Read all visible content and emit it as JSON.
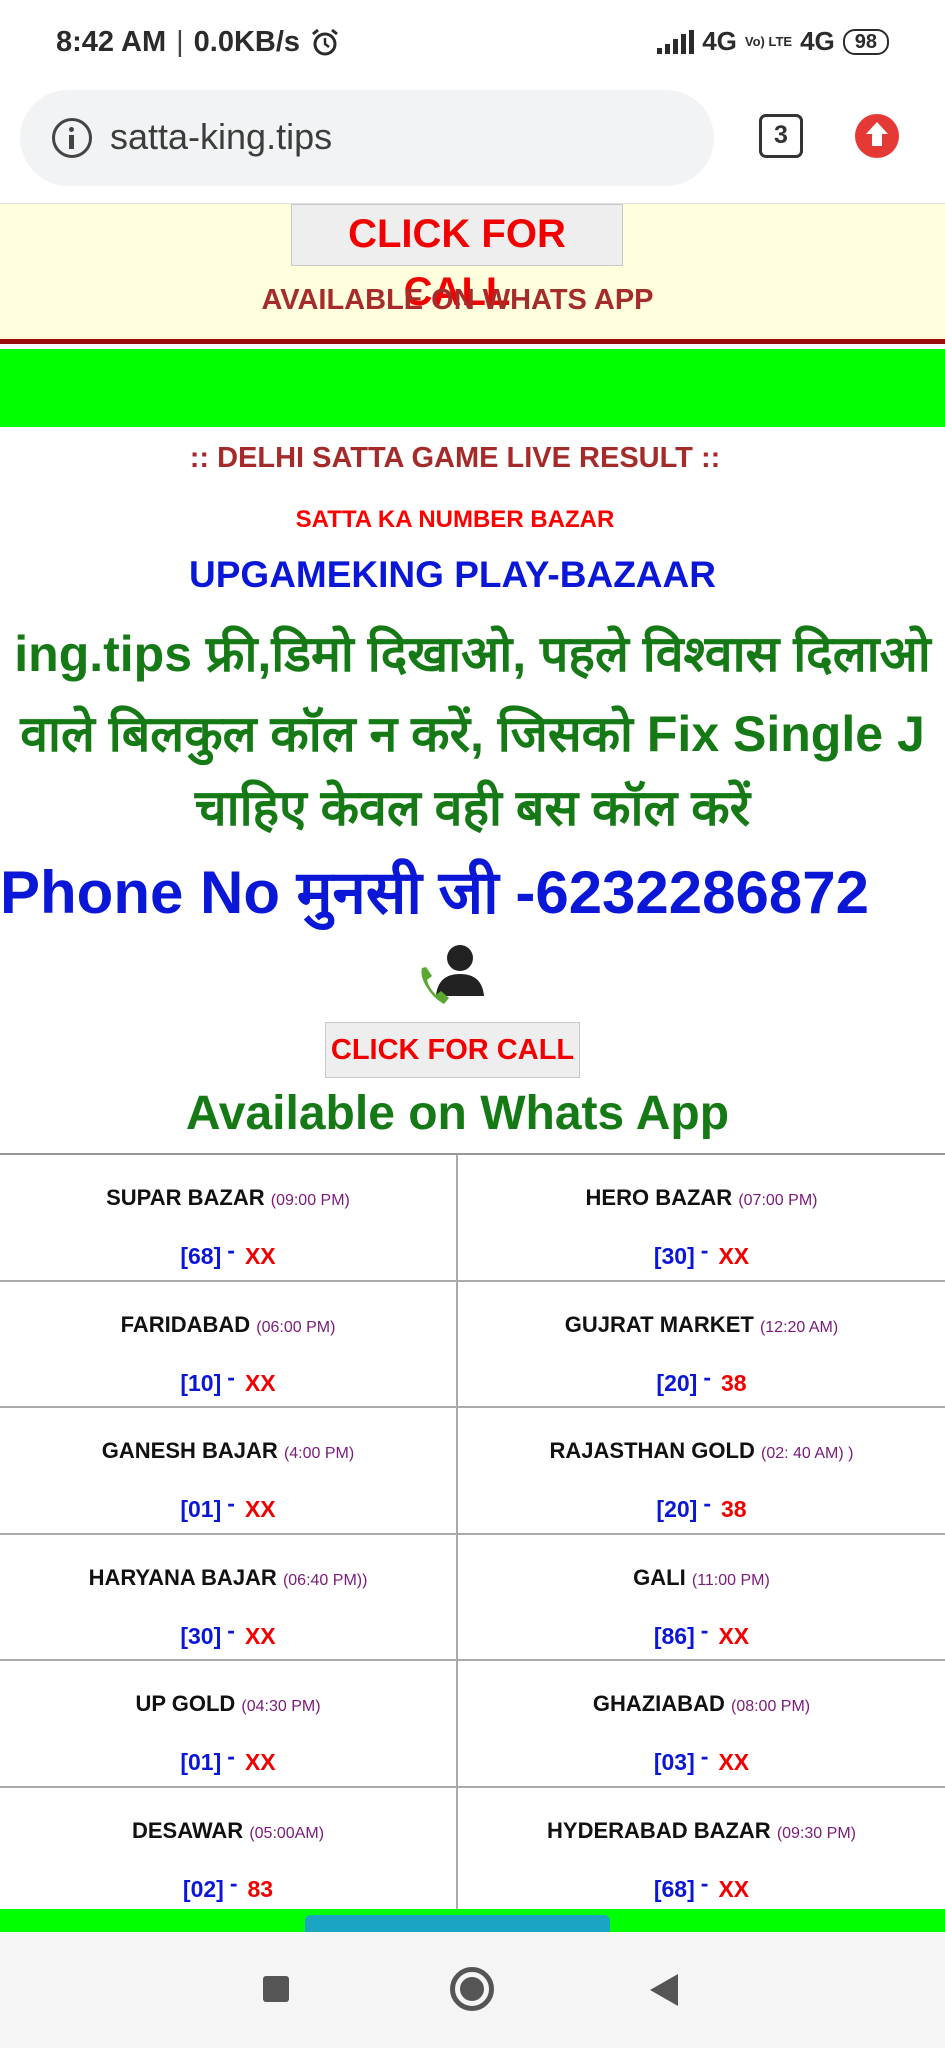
{
  "status_bar": {
    "time": "8:42 AM",
    "network_speed": "0.0KB/s",
    "signal_1": "4G",
    "volte": "Vo) LTE",
    "signal_2": "4G",
    "battery": "98"
  },
  "browser": {
    "url": "satta-king.tips",
    "tab_count": "3"
  },
  "page": {
    "top_call_button": "CLICK FOR CALL",
    "top_available": "AVAILABLE ON WHATS APP",
    "heading_delhi": ":: DELHI SATTA GAME LIVE RESULT ::",
    "heading_satta": "SATTA KA NUMBER BAZAR",
    "heading_upgame": "UPGAMEKING PLAY-BAZAAR",
    "hindi_line_1": "ing.tips फ्री,डिमो दिखाओ, पहले विश्वास दिलाओ",
    "hindi_line_2": "वाले बिलकुल कॉल न करें, जिसको Fix Single J",
    "hindi_line_3": "चाहिए केवल वही बस कॉल करें",
    "phone_line": "Phone No मुनसी जी -6232286872",
    "call_button": "CLICK FOR CALL",
    "available": "Available on Whats App"
  },
  "results": [
    {
      "left": {
        "name": "SUPAR BAZAR",
        "time": "(09:00 PM)",
        "number": "[68]",
        "dash": "-",
        "value": "XX"
      },
      "right": {
        "name": "HERO BAZAR",
        "time": "(07:00 PM)",
        "number": "[30]",
        "dash": "-",
        "value": "XX"
      }
    },
    {
      "left": {
        "name": "FARIDABAD",
        "time": "(06:00 PM)",
        "number": "[10]",
        "dash": "-",
        "value": "XX"
      },
      "right": {
        "name": "GUJRAT MARKET",
        "time": "(12:20 AM)",
        "number": "[20]",
        "dash": "-",
        "value": "38"
      }
    },
    {
      "left": {
        "name": "GANESH BAJAR",
        "time": "(4:00 PM)",
        "number": "[01]",
        "dash": "-",
        "value": "XX"
      },
      "right": {
        "name": "RAJASTHAN GOLD",
        "time": "(02: 40 AM) )",
        "number": "[20]",
        "dash": "-",
        "value": "38"
      }
    },
    {
      "left": {
        "name": "HARYANA BAJAR",
        "time": "(06:40 PM))",
        "number": "[30]",
        "dash": "-",
        "value": "XX"
      },
      "right": {
        "name": "GALI",
        "time": "(11:00 PM)",
        "number": "[86]",
        "dash": "-",
        "value": "XX"
      }
    },
    {
      "left": {
        "name": "UP GOLD",
        "time": "(04:30 PM)",
        "number": "[01]",
        "dash": "-",
        "value": "XX"
      },
      "right": {
        "name": "GHAZIABAD",
        "time": "(08:00 PM)",
        "number": "[03]",
        "dash": "-",
        "value": "XX"
      }
    },
    {
      "left": {
        "name": "DESAWAR",
        "time": "(05:00AM)",
        "number": "[02]",
        "dash": "-",
        "value": "83"
      },
      "right": {
        "name": "HYDERABAD BAZAR",
        "time": "(09:30 PM)",
        "number": "[68]",
        "dash": "-",
        "value": "XX"
      }
    }
  ],
  "icons": {
    "alarm": "alarm-icon",
    "info": "info-icon",
    "update": "update-arrow-icon",
    "call": "phone-contact-icon",
    "nav_recent": "square-icon",
    "nav_home": "circle-icon",
    "nav_back": "triangle-back-icon"
  },
  "colors": {
    "green_band": "#00ff00",
    "call_red": "#f20000",
    "blue_text": "#0b17d6",
    "green_text": "#157a15",
    "banner_bg": "#ffffdd"
  }
}
